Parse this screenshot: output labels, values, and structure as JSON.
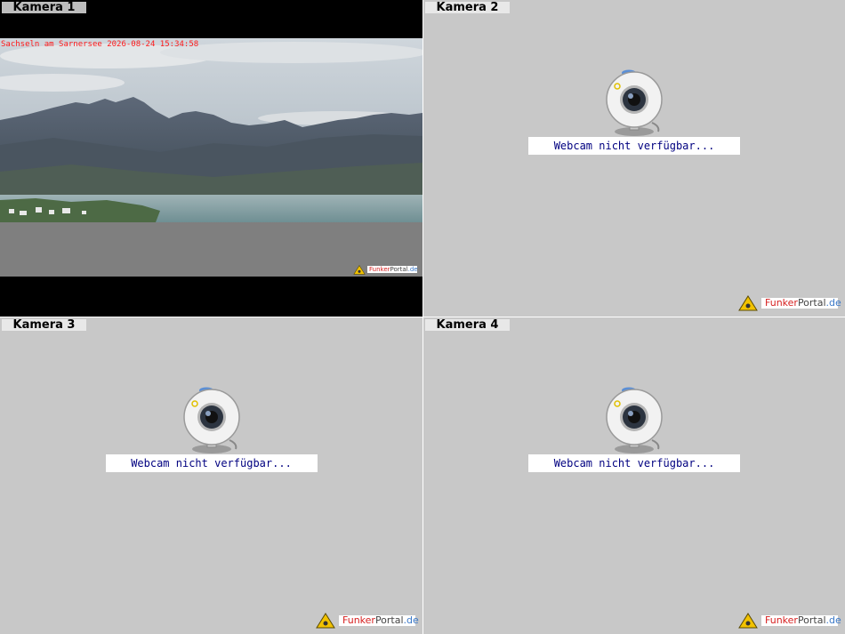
{
  "cameras": [
    {
      "label": "Kamera 1",
      "overlay": "Sachseln am Sarnersee 2026-08-24 15:34:58",
      "available": true
    },
    {
      "label": "Kamera 2",
      "message": "Webcam nicht verfügbar...",
      "available": false
    },
    {
      "label": "Kamera 3",
      "message": "Webcam nicht verfügbar...",
      "available": false
    },
    {
      "label": "Kamera 4",
      "message": "Webcam nicht verfügbar...",
      "available": false
    }
  ],
  "logo": {
    "part1": "Funker",
    "part2": "Portal",
    "part3": ".de"
  },
  "colors": {
    "message_text": "#000080",
    "timestamp": "#ff1a1a",
    "panel_bg": "#c8c8c8"
  }
}
